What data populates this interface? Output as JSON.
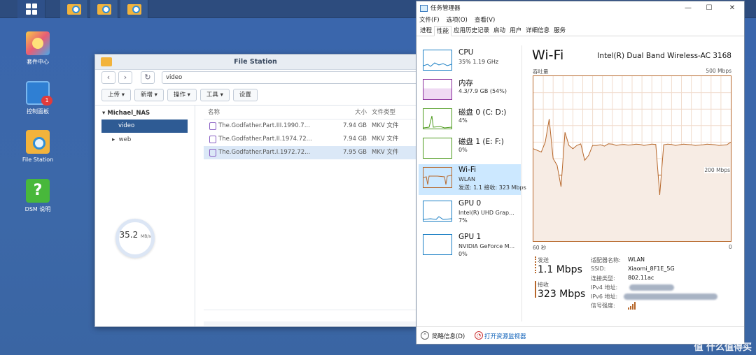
{
  "desktop": {
    "icons": [
      {
        "label": "套件中心"
      },
      {
        "label": "控制面板",
        "badge": "1"
      },
      {
        "label": "File Station"
      },
      {
        "label": "DSM 说明"
      }
    ]
  },
  "file_station": {
    "title": "File Station",
    "path": "video",
    "toolbar": {
      "upload": "上传 ▾",
      "create": "新增 ▾",
      "action": "操作 ▾",
      "tools": "工具 ▾",
      "settings": "设置"
    },
    "tree": {
      "root": "Michael_NAS",
      "selected": "video",
      "other": "web"
    },
    "columns": {
      "name": "名称",
      "size": "大小",
      "type": "文件类型"
    },
    "rows": [
      {
        "name": "The.Godfather.Part.III.1990.7...",
        "size": "7.94 GB",
        "type": "MKV 文件"
      },
      {
        "name": "The.Godfather.Part.II.1974.72...",
        "size": "7.94 GB",
        "type": "MKV 文件"
      },
      {
        "name": "The.Godfather.Part.I.1972.72...",
        "size": "7.95 GB",
        "type": "MKV 文件"
      }
    ],
    "speed_value": "35.2",
    "speed_unit": "MB/s"
  },
  "task_manager": {
    "title": "任务管理器",
    "menu": [
      "文件(F)",
      "选项(O)",
      "查看(V)"
    ],
    "tabs": [
      "进程",
      "性能",
      "应用历史记录",
      "启动",
      "用户",
      "详细信息",
      "服务"
    ],
    "resources": [
      {
        "name": "CPU",
        "line1": "35%  1.19 GHz",
        "line2": ""
      },
      {
        "name": "内存",
        "line1": "4.3/7.9 GB (54%)",
        "line2": ""
      },
      {
        "name": "磁盘 0 (C: D:)",
        "line1": "4%",
        "line2": ""
      },
      {
        "name": "磁盘 1 (E: F:)",
        "line1": "0%",
        "line2": ""
      },
      {
        "name": "Wi-Fi",
        "line1": "WLAN",
        "line2": "发送: 1.1  接收: 323 Mbps"
      },
      {
        "name": "GPU 0",
        "line1": "Intel(R) UHD Grap...",
        "line2": "7%"
      },
      {
        "name": "GPU 1",
        "line1": "NVIDIA GeForce M...",
        "line2": "0%"
      }
    ],
    "wifi": {
      "heading": "Wi-Fi",
      "adapter": "Intel(R) Dual Band Wireless-AC 3168",
      "throughput_label": "吞吐量",
      "max_label": "500 Mbps",
      "mid_label": "200 Mbps",
      "time_left": "60 秒",
      "time_right": "0",
      "send_label": "发送",
      "send_value": "1.1 Mbps",
      "recv_label": "接收",
      "recv_value": "323 Mbps",
      "props": [
        {
          "k": "适配器名称:",
          "v": "WLAN"
        },
        {
          "k": "SSID:",
          "v": "Xiaomi_8F1E_5G"
        },
        {
          "k": "连接类型:",
          "v": "802.11ac"
        },
        {
          "k": "IPv4 地址:",
          "v": ""
        },
        {
          "k": "IPv6 地址:",
          "v": ""
        },
        {
          "k": "信号强度:",
          "v": ""
        }
      ],
      "graph_series": [
        280,
        275,
        270,
        300,
        370,
        250,
        230,
        165,
        330,
        290,
        280,
        290,
        295,
        245,
        260,
        290,
        290,
        292,
        288,
        295,
        294,
        290,
        292,
        293,
        291,
        292,
        294,
        293,
        290,
        292,
        294,
        293,
        140,
        292,
        294,
        293,
        290,
        292,
        294,
        293,
        292,
        290,
        291,
        292,
        294,
        293,
        292,
        290,
        291,
        292,
        300
      ]
    },
    "bottom": {
      "summary": "简略信息(D)",
      "monitor": "打开资源监视器"
    },
    "colors": {
      "graph": "#b7672a",
      "fill": "#f7ece4"
    }
  },
  "watermark": "值 什么值得买"
}
